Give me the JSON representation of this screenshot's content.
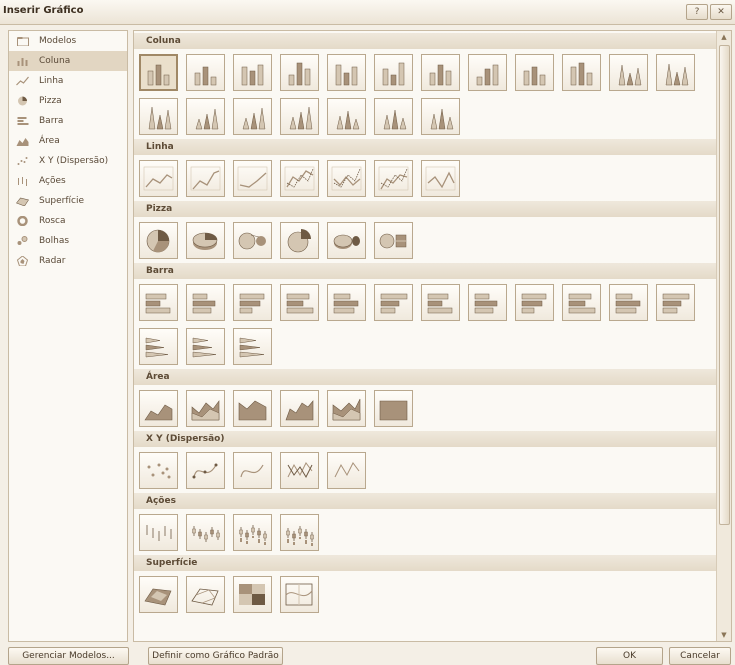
{
  "window": {
    "title": "Inserir Gráfico",
    "help_label": "?",
    "close_label": "✕"
  },
  "sidebar": {
    "items": [
      {
        "label": "Modelos",
        "icon": "folder-icon",
        "selected": false
      },
      {
        "label": "Coluna",
        "icon": "column-chart-icon",
        "selected": true
      },
      {
        "label": "Linha",
        "icon": "line-chart-icon",
        "selected": false
      },
      {
        "label": "Pizza",
        "icon": "pie-chart-icon",
        "selected": false
      },
      {
        "label": "Barra",
        "icon": "bar-chart-icon",
        "selected": false
      },
      {
        "label": "Área",
        "icon": "area-chart-icon",
        "selected": false
      },
      {
        "label": "X Y (Dispersão)",
        "icon": "scatter-chart-icon",
        "selected": false
      },
      {
        "label": "Ações",
        "icon": "stock-chart-icon",
        "selected": false
      },
      {
        "label": "Superfície",
        "icon": "surface-chart-icon",
        "selected": false
      },
      {
        "label": "Rosca",
        "icon": "doughnut-chart-icon",
        "selected": false
      },
      {
        "label": "Bolhas",
        "icon": "bubble-chart-icon",
        "selected": false
      },
      {
        "label": "Radar",
        "icon": "radar-chart-icon",
        "selected": false
      }
    ]
  },
  "sections": [
    {
      "title": "Coluna",
      "type": "column",
      "count": 19
    },
    {
      "title": "Linha",
      "type": "line",
      "count": 7
    },
    {
      "title": "Pizza",
      "type": "pie",
      "count": 6
    },
    {
      "title": "Barra",
      "type": "bar",
      "count": 15
    },
    {
      "title": "Área",
      "type": "area",
      "count": 6
    },
    {
      "title": "X Y (Dispersão)",
      "type": "scatter",
      "count": 5
    },
    {
      "title": "Ações",
      "type": "stock",
      "count": 4
    },
    {
      "title": "Superfície",
      "type": "surface",
      "count": 4
    }
  ],
  "footer": {
    "manage_label": "Gerenciar Modelos...",
    "default_label": "Definir como Gráfico Padrão",
    "ok_label": "OK",
    "cancel_label": "Cancelar"
  },
  "colors": {
    "accent": "#a08866",
    "icon_fill": "#a8927a",
    "icon_light": "#d4c6b2",
    "icon_dark": "#6e5a44"
  }
}
